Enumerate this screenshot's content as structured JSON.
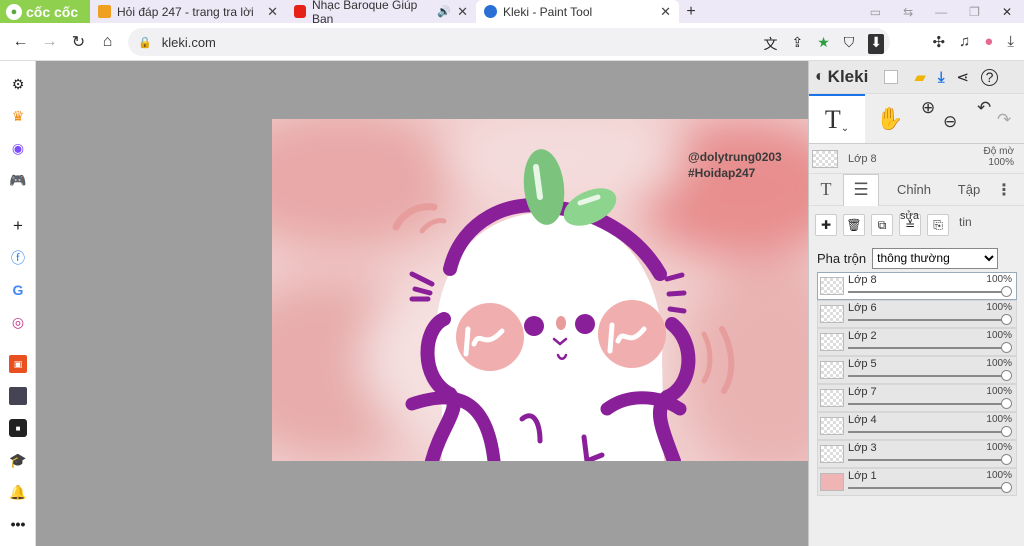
{
  "browser": {
    "brand": "cốc cốc",
    "tabs": [
      {
        "title": "Hỏi đáp 247 - trang tra lời",
        "favicon_color": "#f0a020"
      },
      {
        "title": "Nhạc Baroque Giúp Bạn",
        "favicon_color": "#e62117"
      },
      {
        "title": "Kleki - Paint Tool",
        "favicon_color": "#2a6fd6"
      }
    ],
    "new_tab": "+",
    "url": "kleki.com"
  },
  "canvas_text": {
    "line1": "@dolytrung0203",
    "line2": "#Hoidap247"
  },
  "panel": {
    "app_name": "Kleki",
    "current_layer": "Lớp 8",
    "opacity_label": "Độ mờ",
    "opacity_value": "100%",
    "tabs": [
      "Chỉnh",
      "Tập"
    ],
    "action_label_a": "sửa",
    "action_label_b": "tin",
    "blend_label": "Pha trộn",
    "blend_value": "thông thường",
    "layers": [
      {
        "name": "Lớp 8",
        "opacity": "100%",
        "selected": true
      },
      {
        "name": "Lớp 6",
        "opacity": "100%",
        "selected": false
      },
      {
        "name": "Lớp 2",
        "opacity": "100%",
        "selected": false
      },
      {
        "name": "Lớp 5",
        "opacity": "100%",
        "selected": false
      },
      {
        "name": "Lớp 7",
        "opacity": "100%",
        "selected": false
      },
      {
        "name": "Lớp 4",
        "opacity": "100%",
        "selected": false
      },
      {
        "name": "Lớp 3",
        "opacity": "100%",
        "selected": false
      },
      {
        "name": "Lớp 1",
        "opacity": "100%",
        "selected": false
      }
    ]
  },
  "colors": {
    "brand_green": "#8fd14f",
    "tab_bar": "#ede9f7",
    "workspace": "#9e9e9e",
    "accent_purple": "#8a1f9a",
    "canvas_pink": "#f3d3d3"
  }
}
